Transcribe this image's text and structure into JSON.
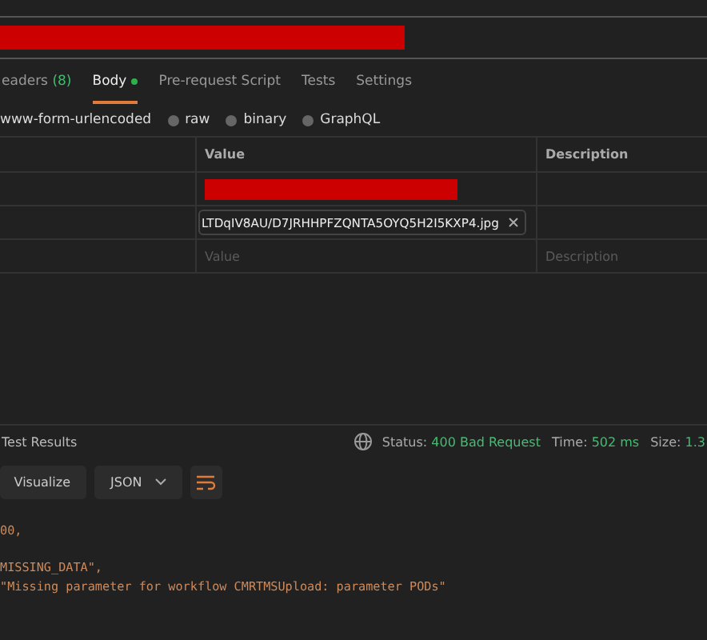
{
  "request_tabs": [
    {
      "label": "eaders",
      "count": "(8)",
      "dot": false,
      "selected": false
    },
    {
      "label": "Body",
      "dot": true,
      "selected": true
    },
    {
      "label": "Pre-request Script",
      "dot": false,
      "selected": false
    },
    {
      "label": "Tests",
      "dot": false,
      "selected": false
    },
    {
      "label": "Settings",
      "dot": false,
      "selected": false
    }
  ],
  "body_type": {
    "label": "www-form-urlencoded",
    "options": [
      {
        "label": "raw",
        "selected": false
      },
      {
        "label": "binary",
        "selected": false
      },
      {
        "label": "GraphQL",
        "selected": false
      }
    ]
  },
  "table": {
    "columns": [
      "",
      "Value",
      "Description"
    ],
    "rows": [
      {
        "kind": "redacted"
      },
      {
        "kind": "file",
        "value": "LTDqIV8AU/D7JRHHPFZQNTA5OYQ5H2I5KXP4.jpg"
      },
      {
        "kind": "placeholder",
        "value_placeholder": "Value",
        "description_placeholder": "Description"
      }
    ]
  },
  "response": {
    "tab": "Test Results",
    "status": [
      {
        "label": "Status:",
        "value": "400 Bad Request"
      },
      {
        "label": "Time:",
        "value": "502 ms"
      },
      {
        "label": "Size:",
        "value": "1.3"
      }
    ],
    "toolbar": {
      "visualize": "Visualize",
      "format": "JSON"
    },
    "code_lines": [
      {
        "text": "00,"
      },
      {
        "text": "MISSING_DATA\",",
        "blank_line_before": true
      },
      {
        "text": "\"Missing parameter for workflow CMRTMSUpload: parameter PODs\""
      }
    ]
  }
}
